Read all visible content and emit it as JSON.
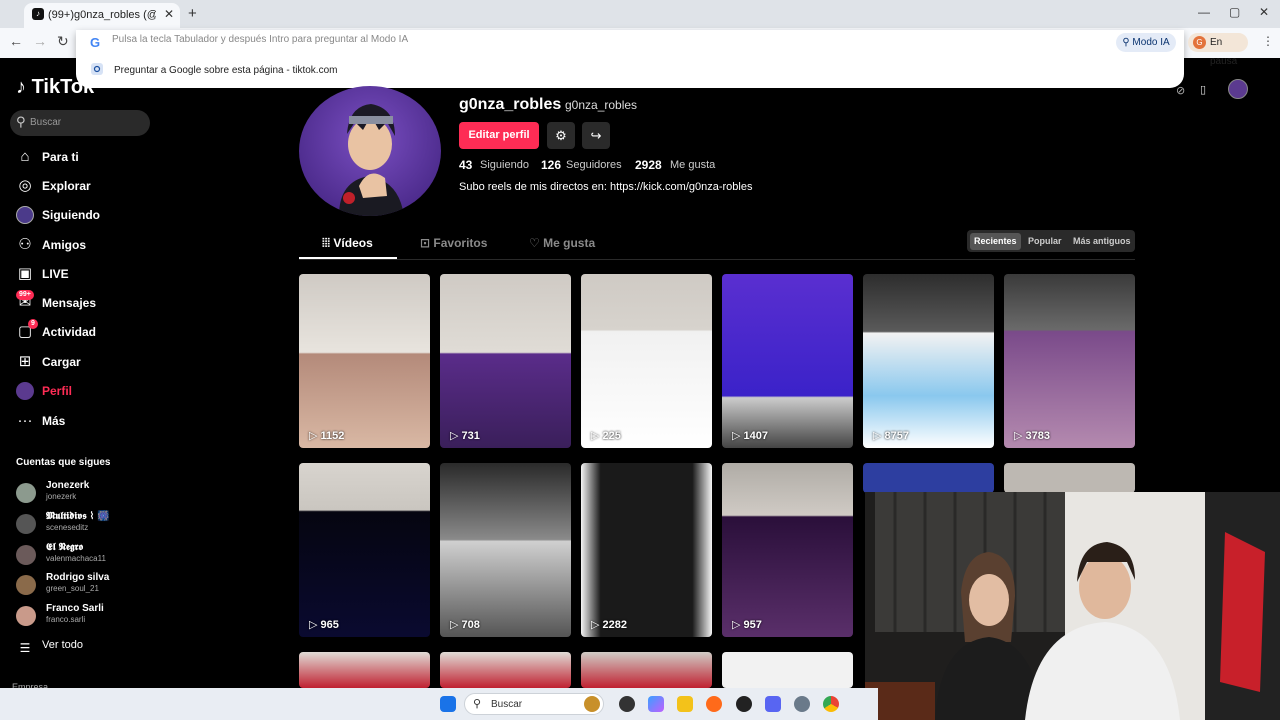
{
  "browser": {
    "tab_title": "(99+)g0nza_robles (@g0nza_ro...",
    "tab_favicon": "tiktok-icon",
    "new_tab": "+",
    "omnibox_placeholder": "Pulsa la tecla Tabulador y después Intro para preguntar al Modo IA",
    "omnibox_suggestion": "Preguntar a Google sobre esta página - tiktok.com",
    "modo_ia": "Modo IA",
    "profile_status": "En pausa",
    "profile_initial": "G",
    "window_controls": [
      "—",
      "▢",
      "✕"
    ]
  },
  "sidebar": {
    "logo": "TikTok",
    "search_placeholder": "Buscar",
    "items": [
      {
        "label": "Para ti",
        "icon": "home-icon"
      },
      {
        "label": "Explorar",
        "icon": "compass-icon"
      },
      {
        "label": "Siguiendo",
        "icon": "following-avatar-icon"
      },
      {
        "label": "Amigos",
        "icon": "friends-icon"
      },
      {
        "label": "LIVE",
        "icon": "live-icon"
      },
      {
        "label": "Mensajes",
        "icon": "messages-icon",
        "badge": "99+"
      },
      {
        "label": "Actividad",
        "icon": "activity-icon",
        "badge": "9"
      },
      {
        "label": "Cargar",
        "icon": "upload-icon"
      },
      {
        "label": "Perfil",
        "icon": "profile-avatar-icon",
        "active": true
      },
      {
        "label": "Más",
        "icon": "more-icon"
      }
    ],
    "following_title": "Cuentas que sigues",
    "following": [
      {
        "name": "Jonezerk",
        "user": "jonezerk"
      },
      {
        "name": "𝕸𝖚𝖑𝖙𝖎𝖉𝖎𝖛𝖘 ⌇ 🎆",
        "user": "sceneseditz"
      },
      {
        "name": "𝕰𝖑 𝕹𝖊𝖌𝖗𝖔",
        "user": "valenmachaca11"
      },
      {
        "name": "Rodrigo silva",
        "user": "green_soul_21"
      },
      {
        "name": "Franco Sarli",
        "user": "franco.sarli"
      }
    ],
    "see_all": "Ver todo",
    "footer": "Empresa"
  },
  "profile": {
    "username": "g0nza_robles",
    "nickname": "g0nza_robles",
    "edit_button": "Editar perfil",
    "following_count": "43",
    "following_label": "Siguiendo",
    "followers_count": "126",
    "followers_label": "Seguidores",
    "likes_count": "2928",
    "likes_label": "Me gusta",
    "bio": "Subo reels de mis directos en: https://kick.com/g0nza-robles"
  },
  "tabs": [
    {
      "label": "Vídeos",
      "active": true
    },
    {
      "label": "Favoritos"
    },
    {
      "label": "Me gusta"
    }
  ],
  "sort_options": [
    {
      "label": "Recientes",
      "active": true
    },
    {
      "label": "Popular"
    },
    {
      "label": "Más antiguos"
    }
  ],
  "videos": [
    {
      "views": "1152"
    },
    {
      "views": "731"
    },
    {
      "views": "225"
    },
    {
      "views": "1407"
    },
    {
      "views": "8757"
    },
    {
      "views": "3783"
    },
    {
      "views": "965"
    },
    {
      "views": "708"
    },
    {
      "views": "2282"
    },
    {
      "views": "957"
    }
  ],
  "taskbar": {
    "search_placeholder": "Buscar"
  }
}
